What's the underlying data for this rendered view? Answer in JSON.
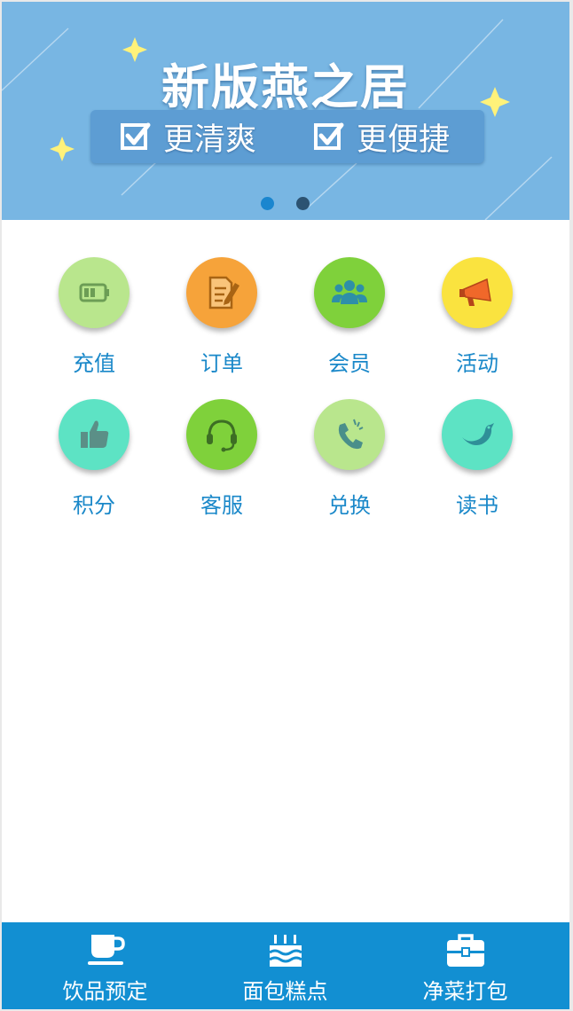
{
  "banner": {
    "title": "新版燕之居",
    "features": [
      "更清爽",
      "更便捷"
    ],
    "slide_count": 2,
    "active_slide": 1
  },
  "grid": {
    "items": [
      {
        "label": "充值",
        "icon": "battery-icon",
        "color": "#b9e68d"
      },
      {
        "label": "订单",
        "icon": "order-edit-icon",
        "color": "#f6a33a"
      },
      {
        "label": "会员",
        "icon": "members-icon",
        "color": "#7fd13b"
      },
      {
        "label": "活动",
        "icon": "megaphone-icon",
        "color": "#fae33f"
      },
      {
        "label": "积分",
        "icon": "thumbs-up-icon",
        "color": "#5de3c4"
      },
      {
        "label": "客服",
        "icon": "headset-icon",
        "color": "#7fd13b"
      },
      {
        "label": "兑换",
        "icon": "phone-icon",
        "color": "#b9e68d"
      },
      {
        "label": "读书",
        "icon": "bird-icon",
        "color": "#5de3c4"
      }
    ]
  },
  "tabbar": {
    "items": [
      {
        "label": "饮品预定",
        "icon": "cup-icon"
      },
      {
        "label": "面包糕点",
        "icon": "cake-icon"
      },
      {
        "label": "净菜打包",
        "icon": "briefcase-icon"
      }
    ],
    "color": "#128fd2"
  }
}
